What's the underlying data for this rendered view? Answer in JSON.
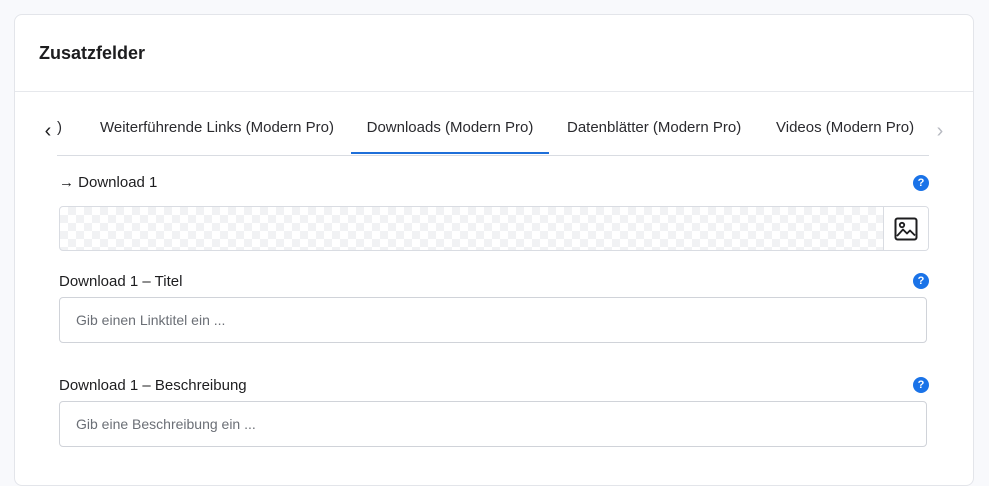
{
  "card": {
    "title": "Zusatzfelder"
  },
  "tabs": {
    "prev_arrow": "‹",
    "next_arrow": "›",
    "items": [
      {
        "label": ")"
      },
      {
        "label": "Weiterführende Links (Modern Pro)"
      },
      {
        "label": "Downloads (Modern Pro)",
        "active": true
      },
      {
        "label": "Datenblätter (Modern Pro)"
      },
      {
        "label": "Videos (Modern Pro)"
      }
    ]
  },
  "fields": {
    "download": {
      "label": "→ Download 1",
      "help": "?"
    },
    "title": {
      "label": "Download 1 – Titel",
      "help": "?",
      "placeholder": "Gib einen Linktitel ein ...",
      "value": ""
    },
    "description": {
      "label": "Download 1 – Beschreibung",
      "help": "?",
      "placeholder": "Gib eine Beschreibung ein ...",
      "value": ""
    }
  },
  "colors": {
    "accent": "#1e6fd9",
    "help": "#1a73e8"
  }
}
